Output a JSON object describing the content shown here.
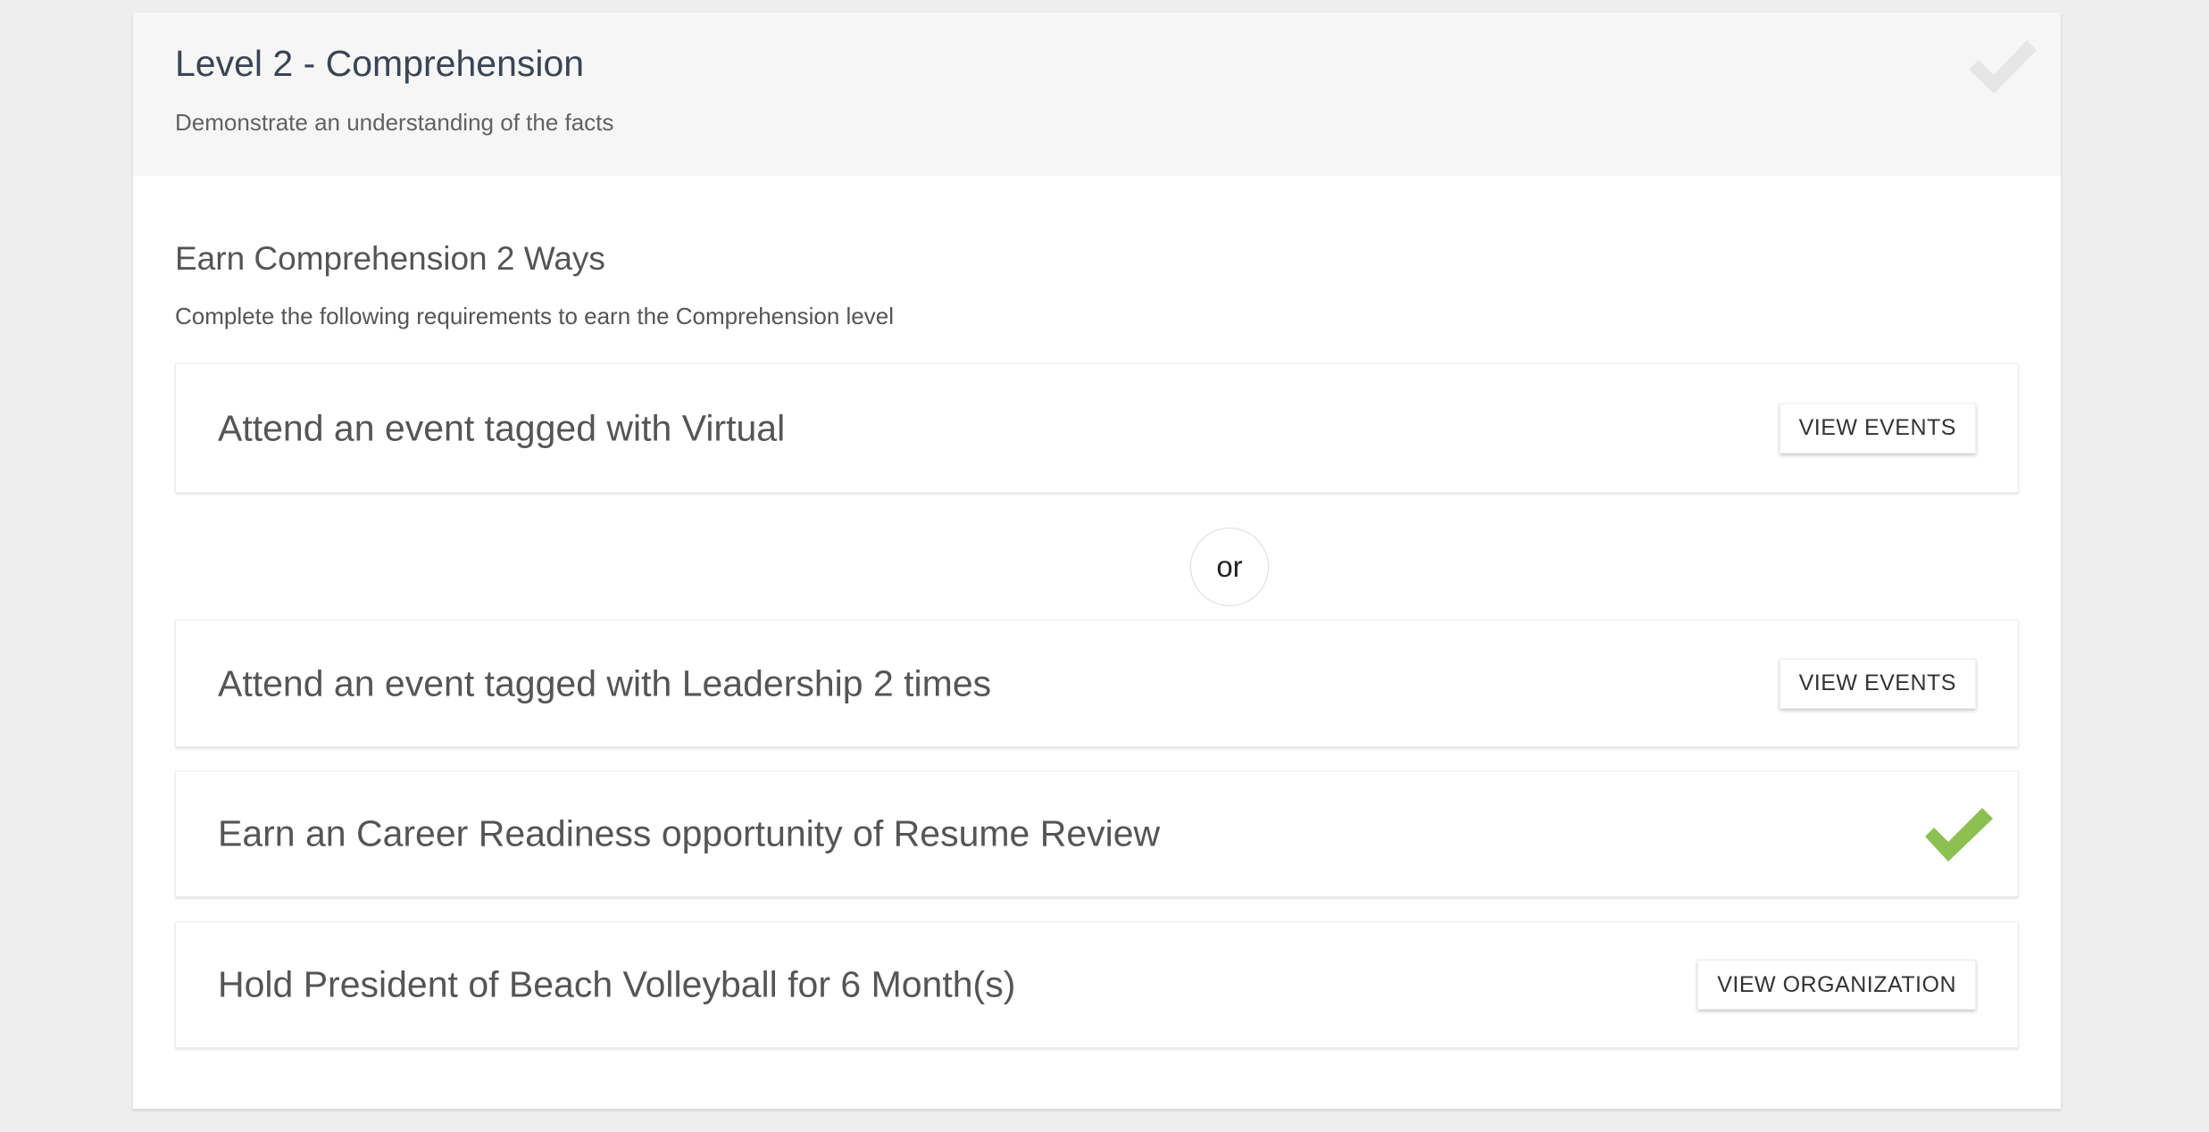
{
  "level": {
    "title": "Level 2 - Comprehension",
    "subtitle": "Demonstrate an understanding of the facts",
    "completed_icon": "check-icon",
    "completed_icon_color": "#e6e6e6"
  },
  "earn": {
    "title": "Earn Comprehension 2 Ways",
    "subtitle": "Complete the following requirements to earn the Comprehension level"
  },
  "separator": {
    "label": "or"
  },
  "requirements": [
    {
      "text": "Attend an event tagged with Virtual",
      "action_label": "VIEW EVENTS",
      "completed": false
    },
    {
      "text": "Attend an event tagged with Leadership 2 times",
      "action_label": "VIEW EVENTS",
      "completed": false
    },
    {
      "text": "Earn an Career Readiness opportunity of Resume Review",
      "completed": true,
      "completed_icon": "check-icon",
      "completed_icon_color": "#8cc152"
    },
    {
      "text": "Hold President of Beach Volleyball for 6 Month(s)",
      "action_label": "VIEW ORGANIZATION",
      "completed": false
    }
  ]
}
